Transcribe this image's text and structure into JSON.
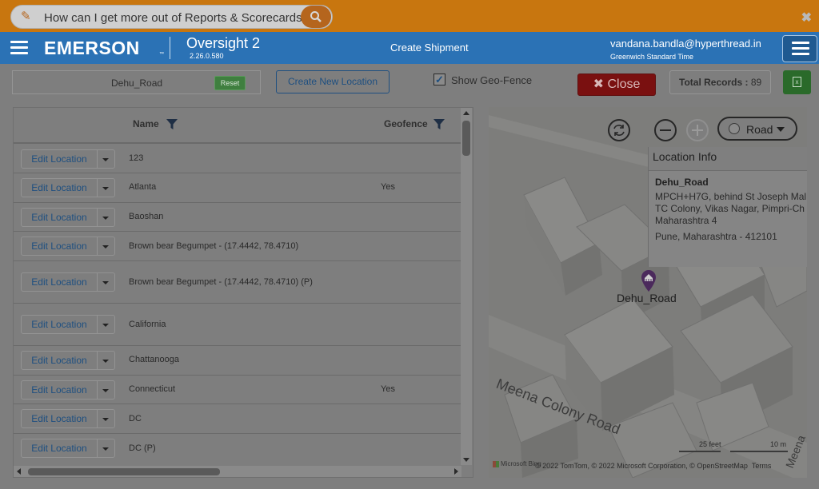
{
  "help": {
    "question": "How can I get more out of Reports & Scorecards?",
    "edit_icon": "pencil-square-icon",
    "search_icon": "search-icon",
    "close_glyph": "✖"
  },
  "header": {
    "logo": "EMERSON",
    "logo_tm": "™",
    "app_title": "Oversight 2",
    "version": "2.26.0.580",
    "page": "Create Shipment",
    "user": "vandana.bandla@hyperthread.in",
    "timezone": "Greenwich Standard Time"
  },
  "toolbar": {
    "search_value": "Dehu_Road",
    "reset_label": "Reset",
    "new_location_label": "Create New Location",
    "geofence_label": "Show Geo-Fence",
    "geofence_checked": true,
    "close_label": "✖ Close",
    "total_records_label": "Total Records :",
    "total_records_value": "89"
  },
  "table": {
    "columns": [
      "Name",
      "Geofence"
    ],
    "edit_label": "Edit Location",
    "rows": [
      {
        "name": "123",
        "geofence": ""
      },
      {
        "name": "Atlanta",
        "geofence": "Yes"
      },
      {
        "name": "Baoshan",
        "geofence": ""
      },
      {
        "name": "Brown bear Begumpet - (17.4442, 78.4710)",
        "geofence": ""
      },
      {
        "name": "Brown bear Begumpet - (17.4442, 78.4710) (P)",
        "geofence": ""
      },
      {
        "name": "California",
        "geofence": ""
      },
      {
        "name": "Chattanooga",
        "geofence": ""
      },
      {
        "name": "Connecticut",
        "geofence": "Yes"
      },
      {
        "name": "DC",
        "geofence": ""
      },
      {
        "name": "DC (P)",
        "geofence": ""
      }
    ]
  },
  "map": {
    "map_type": "Road",
    "info_title": "Location Info",
    "info_name": "Dehu_Road",
    "info_address": "MPCH+H7G, behind St Joseph Mal\nTC Colony, Vikas Nagar, Pimpri-Ch\nMaharashtra 4",
    "info_city": "Pune, Maharashtra - 412101",
    "pin_label": "Dehu_Road",
    "street_main": "Meena Colony Road",
    "street_side": "Meena",
    "scale_feet": "25 feet",
    "scale_m": "10 m",
    "attribution": "© 2022 TomTom, © 2022 Microsoft Corporation, © OpenStreetMap",
    "terms": "Terms",
    "ms_logo": "Microsoft Bing",
    "colors": {
      "overlay": "#7e7e7e",
      "accent": "#2b72b5",
      "help_bar": "#c8760f",
      "pin": "#4b2a5c"
    }
  }
}
